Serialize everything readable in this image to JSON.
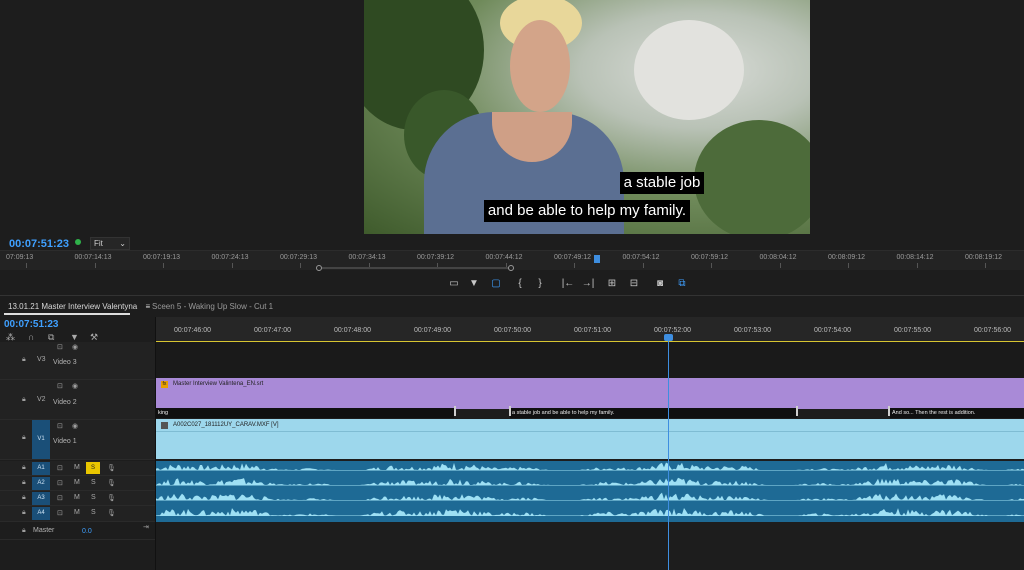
{
  "program_monitor": {
    "timecode": "00:07:51:23",
    "zoom_select": "Fit",
    "subtitle_lines": [
      "a stable job",
      "and be able to help my family."
    ],
    "ruler_ticks": [
      "07:09:13",
      "00:07:14:13",
      "00:07:19:13",
      "00:07:24:13",
      "00:07:29:13",
      "00:07:34:13",
      "00:07:39:12",
      "00:07:44:12",
      "00:07:49:12",
      "00:07:54:12",
      "00:07:59:12",
      "00:08:04:12",
      "00:08:09:12",
      "00:08:14:12",
      "00:08:19:12"
    ],
    "transport": [
      {
        "name": "safe-margins-icon",
        "glyph": "▭"
      },
      {
        "name": "add-marker-icon",
        "glyph": "▼"
      },
      {
        "name": "comment-icon",
        "glyph": "▢"
      },
      {
        "name": "mark-in-icon",
        "glyph": "{"
      },
      {
        "name": "mark-out-icon",
        "glyph": "}"
      },
      {
        "name": "go-to-in-icon",
        "glyph": "|←"
      },
      {
        "name": "go-to-out-icon",
        "glyph": "→|"
      },
      {
        "name": "insert-icon",
        "glyph": "⊞"
      },
      {
        "name": "overwrite-icon",
        "glyph": "⊟"
      },
      {
        "name": "export-frame-icon",
        "glyph": "◙"
      },
      {
        "name": "compare-icon",
        "glyph": "⧉"
      }
    ]
  },
  "timeline": {
    "sequence_tab": "13.01.21 Master Interview Valentyna",
    "menu_glyph": "≡",
    "scene_tab": "Sceen 5 - Waking Up Slow - Cut 1",
    "timecode": "00:07:51:23",
    "ruler_ticks": [
      "00:07:46:00",
      "00:07:47:00",
      "00:07:48:00",
      "00:07:49:00",
      "00:07:50:00",
      "00:07:51:00",
      "00:07:52:00",
      "00:07:53:00",
      "00:07:54:00",
      "00:07:55:00",
      "00:07:56:00"
    ],
    "tracks": {
      "v3": {
        "id": "V3",
        "name": "Video 3"
      },
      "v2": {
        "id": "V2",
        "name": "Video 2"
      },
      "v1": {
        "id": "V1",
        "name": "Video 1"
      },
      "a1": {
        "id": "A1",
        "m": "M",
        "s": "S"
      },
      "a2": {
        "id": "A2",
        "m": "M",
        "s": "S"
      },
      "a3": {
        "id": "A3",
        "m": "M",
        "s": "S"
      },
      "a4": {
        "id": "A4",
        "m": "M",
        "s": "S"
      },
      "master": {
        "name": "Master",
        "value": "0.0"
      }
    },
    "clips": {
      "srt": "Master Interview Valintena_EN.srt",
      "video": "A002C027_181112UY_CARAV.MXF [V]",
      "captions": [
        "king",
        "a stable job and be able to help my family.",
        "And so... Then the rest is addition."
      ]
    }
  },
  "colors": {
    "accent": "#3fa0ff",
    "subtitle_track": "#a98ad7",
    "video_clip": "#9dd7ec",
    "audio_clip": "#1e6a95",
    "solo": "#e9c600"
  }
}
